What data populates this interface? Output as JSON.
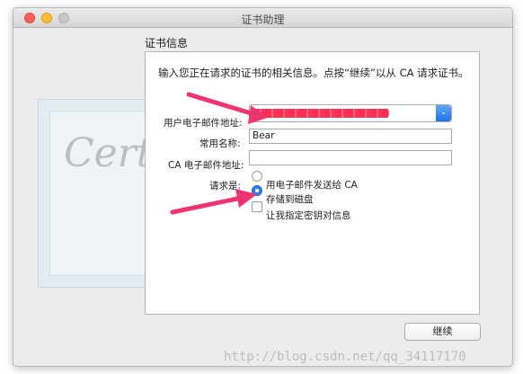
{
  "window": {
    "title": "证书助理"
  },
  "section": {
    "title": "证书信息"
  },
  "description": "输入您正在请求的证书的相关信息。点按“继续”以从 CA 请求证书。",
  "form": {
    "email_label": "用户电子邮件地址:",
    "common_name_label": "常用名称:",
    "common_name_value": "Bear",
    "ca_email_label": "CA 电子邮件地址:",
    "ca_email_value": "",
    "request_label": "请求是:",
    "options": [
      {
        "label": "用电子邮件发送给 CA",
        "selected": false
      },
      {
        "label": "存储到磁盘",
        "selected": true
      }
    ],
    "checkbox_label": "让我指定密钥对信息",
    "checkbox_checked": false
  },
  "background_image_text": "Certif",
  "buttons": {
    "continue": "继续"
  },
  "watermark": "http://blog.csdn.net/qq_34117170",
  "colors": {
    "arrow": "#f0356e",
    "accent": "#2f7ff0",
    "redaction": "#ff2d55"
  }
}
